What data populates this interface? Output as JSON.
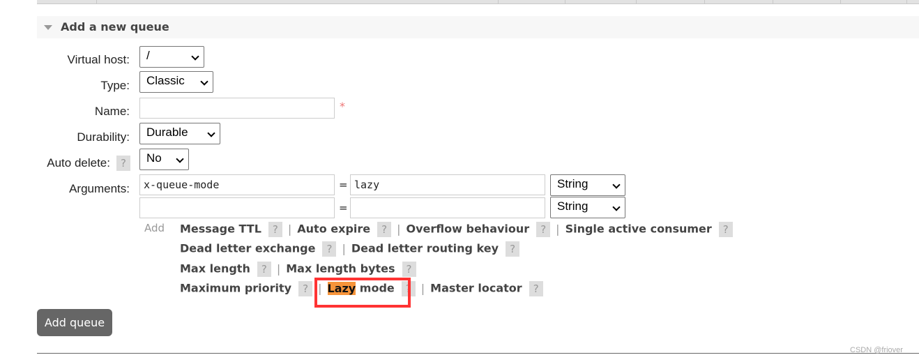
{
  "section": {
    "title": "Add a new queue"
  },
  "form": {
    "virtual_host": {
      "label": "Virtual host:",
      "value": "/"
    },
    "type": {
      "label": "Type:",
      "value": "Classic"
    },
    "name": {
      "label": "Name:",
      "value": "",
      "required_mark": "*"
    },
    "durability": {
      "label": "Durability:",
      "value": "Durable"
    },
    "auto_delete": {
      "label": "Auto delete:",
      "value": "No",
      "help": "?"
    },
    "arguments": {
      "label": "Arguments:",
      "rows": [
        {
          "key": "x-queue-mode",
          "eq": "=",
          "value": "lazy",
          "type": "String"
        },
        {
          "key": "",
          "eq": "=",
          "value": "",
          "type": "String"
        }
      ]
    }
  },
  "add_links": {
    "label": "Add",
    "help": "?",
    "sep": "|",
    "rows": [
      [
        "Message TTL",
        "Auto expire",
        "Overflow behaviour",
        "Single active consumer"
      ],
      [
        "Dead letter exchange",
        "Dead letter routing key"
      ],
      [
        "Max length",
        "Max length bytes"
      ],
      [
        "Maximum priority",
        "Lazy mode",
        "Master locator"
      ]
    ],
    "highlight": "Lazy",
    "highlight_color": "#f7943a",
    "annotation_color": "#ff3333"
  },
  "submit": {
    "label": "Add queue"
  },
  "watermark": "CSDN @friover"
}
